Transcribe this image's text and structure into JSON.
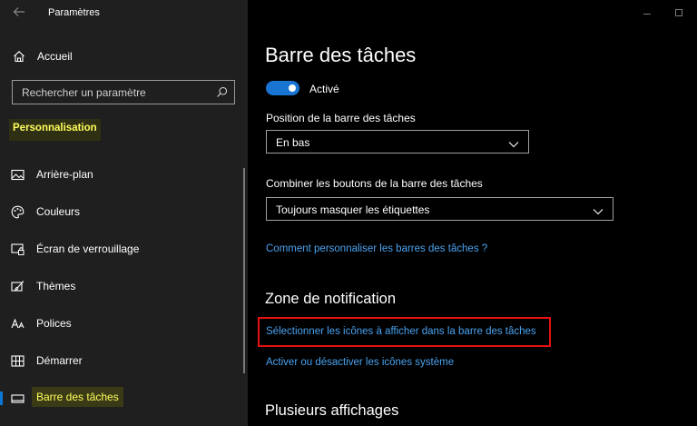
{
  "window": {
    "app_title": "Paramètres"
  },
  "sidebar": {
    "home_label": "Accueil",
    "search_placeholder": "Rechercher un paramètre",
    "section_label": "Personnalisation",
    "items": [
      {
        "label": "Arrière-plan",
        "icon": "picture-icon"
      },
      {
        "label": "Couleurs",
        "icon": "palette-icon"
      },
      {
        "label": "Écran de verrouillage",
        "icon": "lock-screen-icon"
      },
      {
        "label": "Thèmes",
        "icon": "brush-icon"
      },
      {
        "label": "Polices",
        "icon": "font-icon"
      },
      {
        "label": "Démarrer",
        "icon": "start-icon"
      },
      {
        "label": "Barre des tâches",
        "icon": "taskbar-icon",
        "active": true
      }
    ]
  },
  "main": {
    "title": "Barre des tâches",
    "toggle": {
      "state": "on",
      "label": "Activé"
    },
    "position_label": "Position de la barre des tâches",
    "position_value": "En bas",
    "combine_label": "Combiner les boutons de la barre des tâches",
    "combine_value": "Toujours masquer les étiquettes",
    "help_link": "Comment personnaliser les barres des tâches ?",
    "notification_title": "Zone de notification",
    "select_icons_link": "Sélectionner les icônes à afficher dans la barre des tâches",
    "system_icons_link": "Activer ou désactiver les icônes système",
    "multi_display_title": "Plusieurs affichages"
  },
  "colors": {
    "accent": "#1975d2",
    "link": "#4aa3f0",
    "highlight_text": "#ffff5c",
    "highlight_border": "#e81010"
  }
}
